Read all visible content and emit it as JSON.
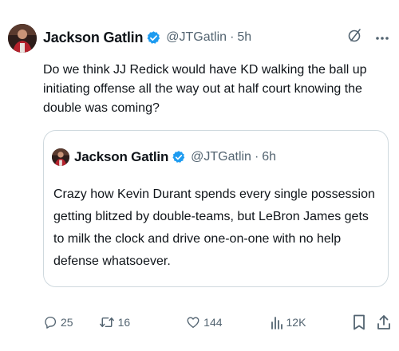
{
  "tweet": {
    "author_name": "Jackson Gatlin",
    "handle": "@JTGatlin",
    "separator": "·",
    "time": "5h",
    "text": "Do we think JJ Redick would have KD walking the ball up initiating offense all the way out at half court knowing the double was coming?"
  },
  "quoted_tweet": {
    "author_name": "Jackson Gatlin",
    "handle": "@JTGatlin",
    "separator": "·",
    "time": "6h",
    "text": "Crazy how Kevin Durant spends every single possession getting blitzed by double-teams, but LeBron James gets to milk the clock and drive one-on-one with no help defense whatsoever."
  },
  "actions": {
    "replies": "25",
    "reposts": "16",
    "likes": "144",
    "views": "12K"
  },
  "icons": {
    "verified": "verified-badge-icon",
    "grok": "grok-icon",
    "more": "more-icon",
    "reply": "reply-icon",
    "repost": "repost-icon",
    "like": "heart-icon",
    "views": "views-icon",
    "bookmark": "bookmark-icon",
    "share": "share-icon"
  },
  "colors": {
    "verified": "#1d9bf0",
    "text": "#0f1419",
    "muted": "#536471",
    "border": "#cfd9de"
  }
}
